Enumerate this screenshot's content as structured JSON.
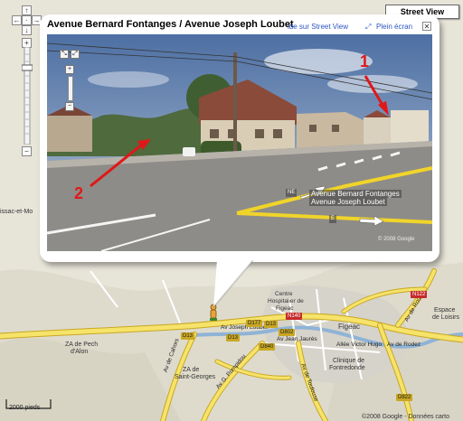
{
  "street_view_button": "Street View",
  "controls": {
    "pan_up": "↑",
    "pan_left": "←",
    "pan_right": "→",
    "pan_down": "↓",
    "pan_center": "·",
    "zoom_in": "+",
    "zoom_out": "−"
  },
  "bubble": {
    "title": "Avenue Bernard Fontanges / Avenue Joseph Loubet",
    "link_street_view": "ide sur Street View",
    "link_fullscreen": "Plein écran",
    "close": "✕"
  },
  "street_view": {
    "zoom_in": "+",
    "zoom_out": "−",
    "compass_ne": "NE",
    "compass_e": "E",
    "street_label_1": "Avenue Bernard Fontanges",
    "street_label_2": "Avenue Joseph Loubet",
    "watermark": "© 2008 Google",
    "annotation_1": "1",
    "annotation_2": "2"
  },
  "map": {
    "place_labels": {
      "issac": "issac-et-Mo",
      "centre_hosp_1": "Centre",
      "centre_hosp_2": "Hospitalier de",
      "centre_hosp_3": "Figeac",
      "figeac": "Figeac",
      "espace_loisirs_1": "Espace",
      "espace_loisirs_2": "de Loisirs",
      "za_pech_1": "ZA de Pech",
      "za_pech_2": "d'Alon",
      "za_st_georges_1": "ZA de",
      "za_st_georges_2": "Saint-Georges",
      "clinique_1": "Clinique de",
      "clinique_2": "Fontredonde"
    },
    "road_labels": {
      "joseph_loubet": "Av Joseph Loubet",
      "victor_hugo": "Allée Victor Hugo",
      "av_rodez_1": "Av de Rodez",
      "av_rodez_2": "Av de Rodez",
      "av_cahors": "Av de Cahors",
      "pompidou": "Av G. Pompidou",
      "jean_jaures": "Av Jean Jaurès",
      "toulouse": "Av de Toulouse"
    },
    "shields": {
      "d177": "D177",
      "d13a": "D13",
      "d13b": "D13",
      "d13c": "D13",
      "d802": "D802",
      "d840": "D840",
      "n140": "N140",
      "n122": "N122",
      "d822": "D822"
    },
    "scale": "2000 pieds",
    "copyright": "©2008 Google - Données carto"
  },
  "colors": {
    "road_yellow": "#f6e36a",
    "road_border": "#c9a722",
    "river": "#8fb3d6",
    "urban": "#d9d6cd",
    "terrain": "#e9e6dc",
    "annotation_red": "#e01818",
    "link_blue": "#2b55c4"
  }
}
